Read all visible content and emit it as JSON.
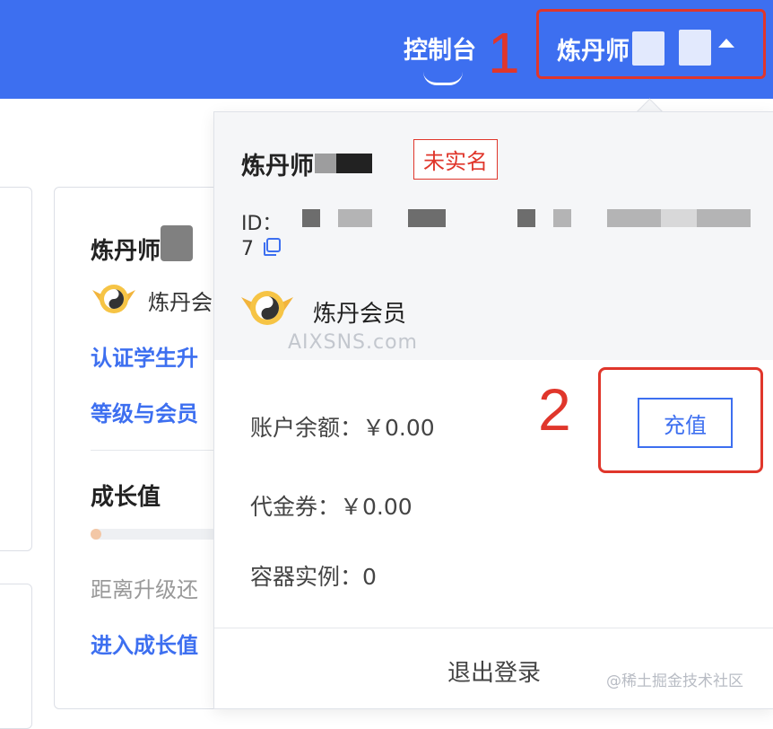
{
  "topbar": {
    "console_label": "控制台",
    "user_name": "炼丹师",
    "step1": "1"
  },
  "background_card": {
    "user_name": "炼丹师",
    "member_label": "炼丹会员",
    "link_verify": "认证学生升",
    "link_level": "等级与会员",
    "growth_title": "成长值",
    "upgrade_text": "距离升级还",
    "link_growth": "进入成长值"
  },
  "dropdown": {
    "user_name": "炼丹师",
    "verify_badge": "未实名",
    "id_label": "ID：",
    "id_tail": "7",
    "member_label": "炼丹会员",
    "watermark": "AIXSNS.com",
    "balance": "账户余额：￥0.00",
    "voucher": "代金券：￥0.00",
    "instances": "容器实例：0",
    "recharge_label": "充值",
    "step2": "2",
    "logout_label": "退出登录"
  },
  "watermark_footer": "@稀土掘金技术社区",
  "colors": {
    "topbar": "#3d6ff0",
    "accent": "#3d6ff0",
    "highlight": "#e0362b",
    "panel_head_bg": "#f5f6f8"
  }
}
